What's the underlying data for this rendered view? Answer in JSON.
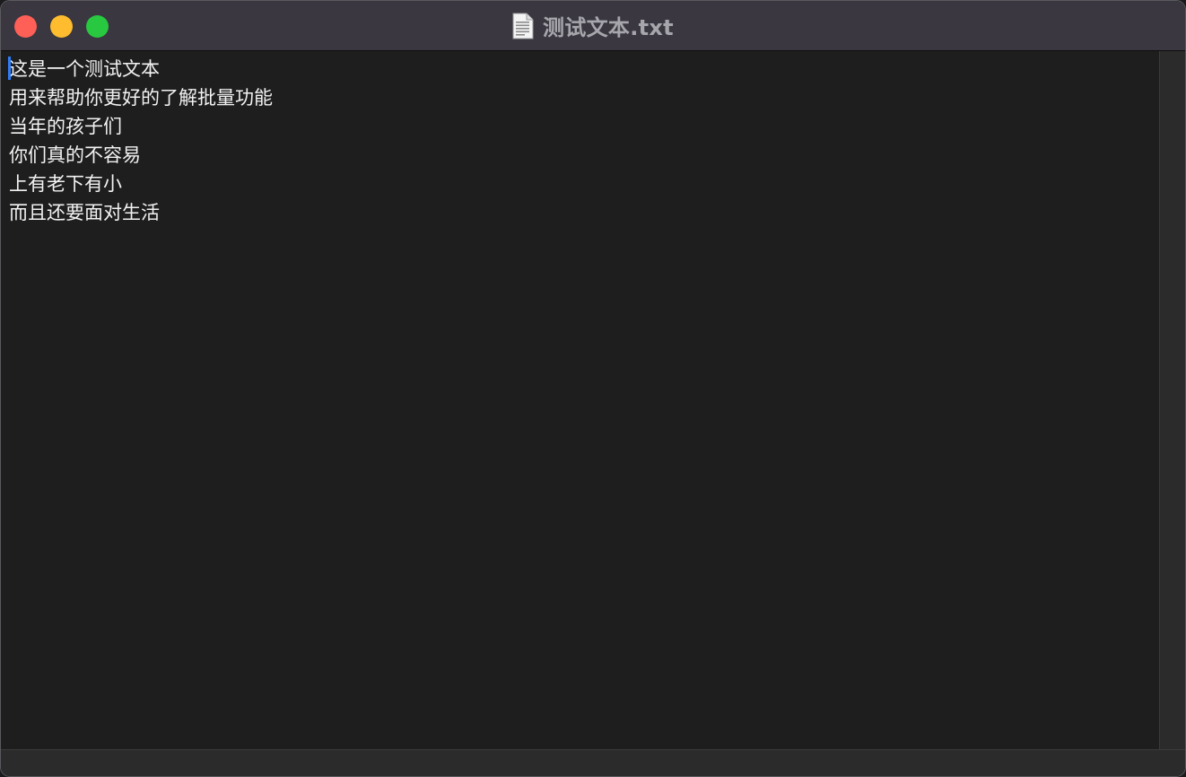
{
  "window": {
    "title": "测试文本.txt",
    "title_icon": "text-document-icon"
  },
  "editor": {
    "lines": [
      "这是一个测试文本",
      "用来帮助你更好的了解批量功能",
      "当年的孩子们",
      "你们真的不容易",
      "上有老下有小",
      "而且还要面对生活"
    ]
  },
  "colors": {
    "close": "#fe5f57",
    "minimize": "#febc2e",
    "zoom": "#28c840",
    "titlebar": "#3a3740",
    "editor_bg": "#1e1e1e",
    "text": "#f2f2f2",
    "caret": "#2f7cf6"
  }
}
